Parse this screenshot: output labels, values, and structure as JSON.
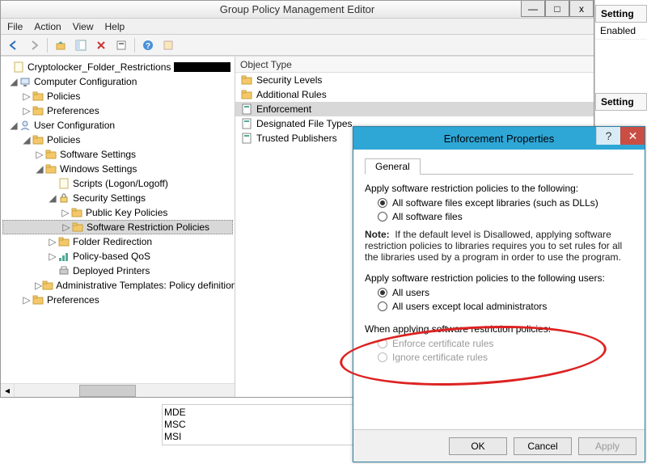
{
  "window": {
    "title": "Group Policy Management Editor",
    "controls": {
      "min": "—",
      "max": "□",
      "close": "x"
    },
    "menu": {
      "file": "File",
      "action": "Action",
      "view": "View",
      "help": "Help"
    }
  },
  "tree": {
    "root": "Cryptolocker_Folder_Restrictions",
    "computer_config": "Computer Configuration",
    "cc_policies": "Policies",
    "cc_prefs": "Preferences",
    "user_config": "User Configuration",
    "uc_policies": "Policies",
    "software_settings": "Software Settings",
    "windows_settings": "Windows Settings",
    "scripts": "Scripts (Logon/Logoff)",
    "security_settings": "Security Settings",
    "pk_policies": "Public Key Policies",
    "srp": "Software Restriction Policies",
    "folder_redirection": "Folder Redirection",
    "policy_qos": "Policy-based QoS",
    "deployed_printers": "Deployed Printers",
    "admin_templates": "Administrative Templates: Policy definitions",
    "uc_prefs": "Preferences"
  },
  "list": {
    "header": "Object Type",
    "items": {
      "security_levels": "Security Levels",
      "additional_rules": "Additional Rules",
      "enforcement": "Enforcement",
      "designated_file_types": "Designated File Types",
      "trusted_publishers": "Trusted Publishers"
    }
  },
  "rightpanel": {
    "setting_head": "Setting",
    "enabled": "Enabled",
    "setting_head2": "Setting"
  },
  "dialog": {
    "title": "Enforcement Properties",
    "help": "?",
    "close": "✕",
    "tab_general": "General",
    "apply_following": "Apply software restriction policies to the following:",
    "radio_except_libs": "All software files except libraries (such as DLLs)",
    "radio_all_files": "All software files",
    "note_prefix": "Note:",
    "note_body": "If the default level is Disallowed, applying software restriction policies to libraries requires you to set rules for all the libraries used by a program in order to use the program.",
    "apply_users": "Apply software restriction policies to the following users:",
    "radio_all_users": "All users",
    "radio_except_admins": "All users except local administrators",
    "when_applying": "When applying software restriction policies:",
    "radio_enforce_cert": "Enforce certificate rules",
    "radio_ignore_cert": "Ignore certificate rules",
    "ok": "OK",
    "cancel": "Cancel",
    "apply_btn": "Apply"
  },
  "filelist": {
    "a": "MDE",
    "b": "MSC",
    "c": "MSI"
  }
}
